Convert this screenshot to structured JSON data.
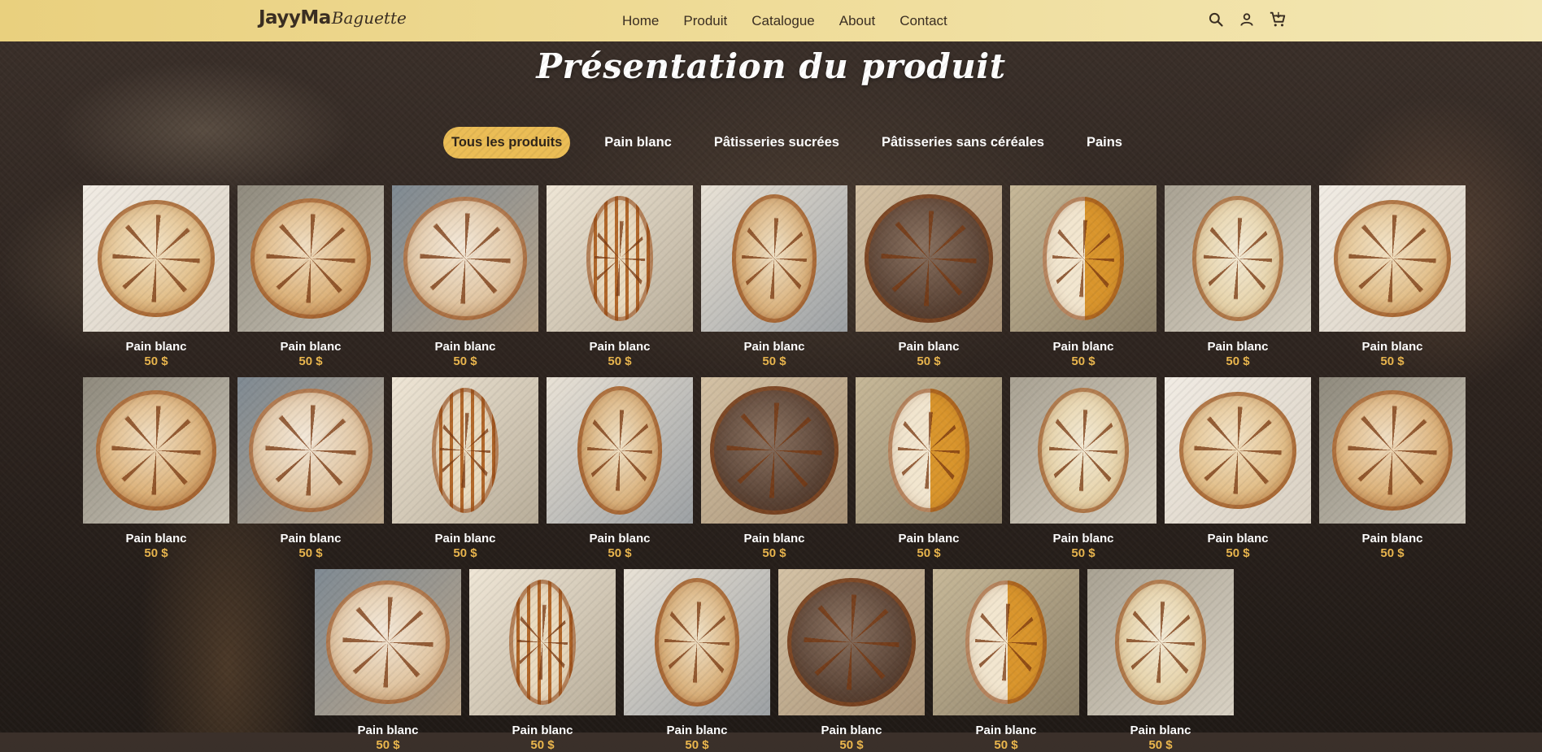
{
  "brand": {
    "name": "JayyMa",
    "script": "Baguette"
  },
  "nav": [
    "Home",
    "Produit",
    "Catalogue",
    "About",
    "Contact"
  ],
  "header_icons": [
    "search-icon",
    "user-icon",
    "cart-icon"
  ],
  "page_title": "Présentation du produit",
  "tabs": [
    {
      "label": "Tous les produits",
      "active": true
    },
    {
      "label": "Pain blanc",
      "active": false
    },
    {
      "label": "Pâtisseries sucrées",
      "active": false
    },
    {
      "label": "Pâtisseries sans céréales",
      "active": false
    },
    {
      "label": "Pains",
      "active": false
    }
  ],
  "colors": {
    "accent": "#ebbd55",
    "price": "#eab64d",
    "header": "#ecd68b"
  },
  "products": [
    {
      "name": "Pain blanc",
      "price": "50 $",
      "style": "round-light"
    },
    {
      "name": "Pain blanc",
      "price": "50 $",
      "style": "round-leaf"
    },
    {
      "name": "Pain blanc",
      "price": "50 $",
      "style": "round-flower"
    },
    {
      "name": "Pain blanc",
      "price": "50 $",
      "style": "oval-striped"
    },
    {
      "name": "Pain blanc",
      "price": "50 $",
      "style": "oval-wheat"
    },
    {
      "name": "Pain blanc",
      "price": "50 $",
      "style": "round-dark"
    },
    {
      "name": "Pain blanc",
      "price": "50 $",
      "style": "oval-stencil"
    },
    {
      "name": "Pain blanc",
      "price": "50 $",
      "style": "oval-pale"
    },
    {
      "name": "Pain blanc",
      "price": "50 $",
      "style": "round-light"
    },
    {
      "name": "Pain blanc",
      "price": "50 $",
      "style": "round-leaf"
    },
    {
      "name": "Pain blanc",
      "price": "50 $",
      "style": "round-flower"
    },
    {
      "name": "Pain blanc",
      "price": "50 $",
      "style": "oval-striped"
    },
    {
      "name": "Pain blanc",
      "price": "50 $",
      "style": "oval-wheat"
    },
    {
      "name": "Pain blanc",
      "price": "50 $",
      "style": "round-dark"
    },
    {
      "name": "Pain blanc",
      "price": "50 $",
      "style": "oval-stencil"
    },
    {
      "name": "Pain blanc",
      "price": "50 $",
      "style": "oval-pale"
    },
    {
      "name": "Pain blanc",
      "price": "50 $",
      "style": "round-light"
    },
    {
      "name": "Pain blanc",
      "price": "50 $",
      "style": "round-leaf"
    },
    {
      "name": "Pain blanc",
      "price": "50 $",
      "style": "round-flower"
    },
    {
      "name": "Pain blanc",
      "price": "50 $",
      "style": "oval-striped"
    },
    {
      "name": "Pain blanc",
      "price": "50 $",
      "style": "oval-wheat"
    },
    {
      "name": "Pain blanc",
      "price": "50 $",
      "style": "round-dark"
    },
    {
      "name": "Pain blanc",
      "price": "50 $",
      "style": "oval-stencil"
    },
    {
      "name": "Pain blanc",
      "price": "50 $",
      "style": "oval-pale"
    }
  ]
}
